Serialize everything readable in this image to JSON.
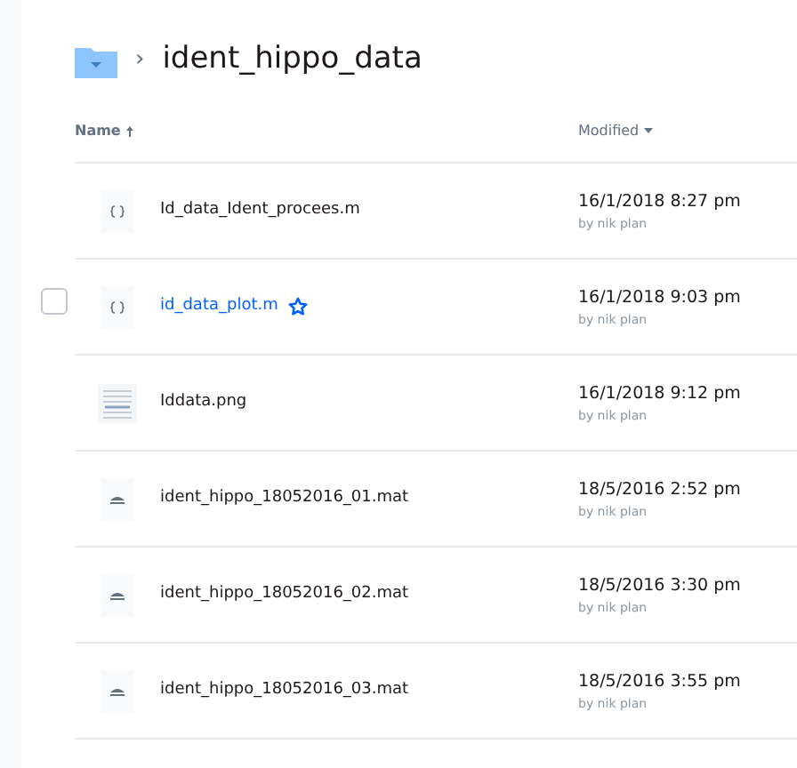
{
  "breadcrumb": {
    "separator": "›",
    "folder": "ident_hippo_data"
  },
  "columns": [
    {
      "label": "Name",
      "ascending": true
    },
    {
      "label": "Modified",
      "ascending": false
    }
  ],
  "rows": [
    {
      "kind": "code",
      "name": "Id_data_Ident_procees.m",
      "hovered": false,
      "starred": false,
      "modified": "16/1/2018 8:27 pm",
      "by": "by nik plan"
    },
    {
      "kind": "code",
      "name": "id_data_plot.m",
      "hovered": true,
      "starred": true,
      "modified": "16/1/2018 9:03 pm",
      "by": "by nik plan"
    },
    {
      "kind": "image",
      "name": "Iddata.png",
      "hovered": false,
      "starred": false,
      "modified": "16/1/2018 9:12 pm",
      "by": "by nik plan"
    },
    {
      "kind": "data",
      "name": "ident_hippo_18052016_01.mat",
      "hovered": false,
      "starred": false,
      "modified": "18/5/2016 2:52 pm",
      "by": "by nik plan"
    },
    {
      "kind": "data",
      "name": "ident_hippo_18052016_02.mat",
      "hovered": false,
      "starred": false,
      "modified": "18/5/2016 3:30 pm",
      "by": "by nik plan"
    },
    {
      "kind": "data",
      "name": "ident_hippo_18052016_03.mat",
      "hovered": false,
      "starred": false,
      "modified": "18/5/2016 3:55 pm",
      "by": "by nik plan"
    }
  ]
}
